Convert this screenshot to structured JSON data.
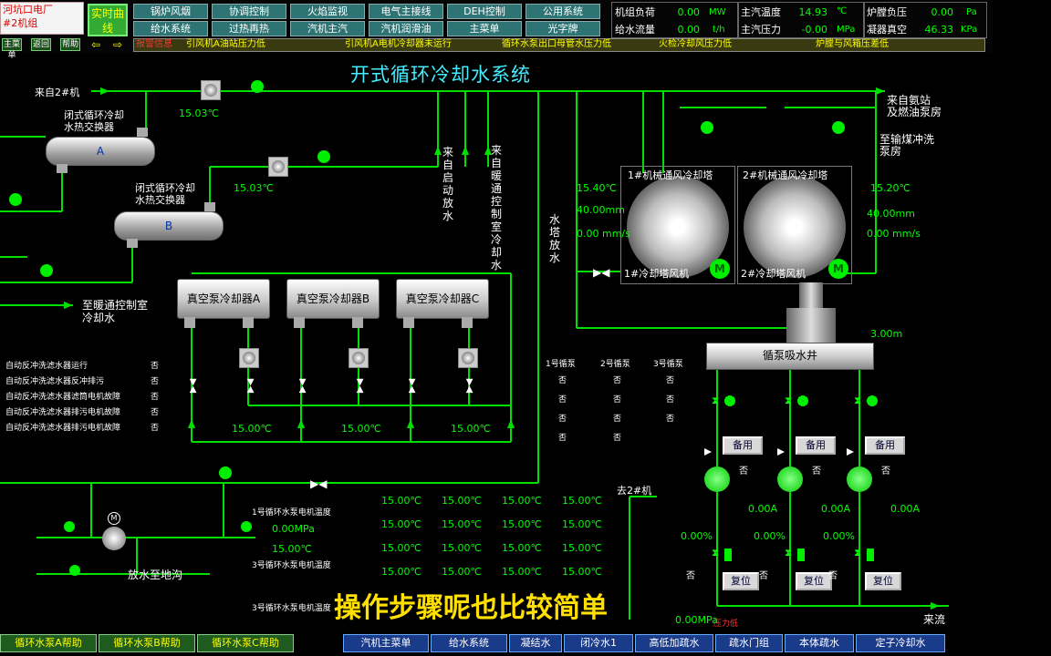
{
  "header": {
    "plant_name": "河坑口电厂",
    "unit_name": "#2机组",
    "realtime_curve": "实时曲线",
    "nav_row1": [
      "锅炉风烟",
      "协调控制",
      "火焰监视",
      "电气主接线",
      "DEH控制",
      "公用系统"
    ],
    "nav_row2": [
      "给水系统",
      "过热再热",
      "汽机主汽",
      "汽机润滑油",
      "主菜单",
      "光字牌"
    ],
    "mini_buttons": [
      "主菜单",
      "返回",
      "帮助"
    ],
    "arrow_prev": "⇦",
    "arrow_next": "⇨",
    "metrics_left": [
      {
        "label": "机组负荷",
        "value": "0.00",
        "unit": "MW"
      },
      {
        "label": "给水流量",
        "value": "0.00",
        "unit": "t/h"
      }
    ],
    "metrics_mid": [
      {
        "label": "主汽温度",
        "value": "14.93",
        "unit": "℃"
      },
      {
        "label": "主汽压力",
        "value": "-0.00",
        "unit": "MPa"
      }
    ],
    "metrics_right": [
      {
        "label": "炉膛负压",
        "value": "0.00",
        "unit": "Pa"
      },
      {
        "label": "凝器真空",
        "value": "46.33",
        "unit": "KPa"
      }
    ],
    "alarm_title": "报警信息",
    "alarms": [
      "引风机A油站压力低",
      "引风机A电机冷却器未运行",
      "循环水泵出口母管水压力低",
      "火检冷却风压力低",
      "炉膛与风箱压差低"
    ]
  },
  "title": "开式循环冷却水系统",
  "labels": {
    "from_2": "来自2#机",
    "hx_a_label": "闭式循环冷却\n水热交换器",
    "hx_b_label": "闭式循环冷却\n水热交换器",
    "hx_a": "A",
    "hx_b": "B",
    "temp_a": "15.03℃",
    "temp_b": "15.03℃",
    "hvac_room": "至暖通控制室\n冷却水",
    "v_start_drain": "来自启动放水",
    "v_hvac": "来自暖通控制室冷却水",
    "tower_drain": "水塔放水",
    "tower1_name": "1#机械通风冷却塔",
    "tower2_name": "2#机械通风冷却塔",
    "tower1_fan": "1#冷却塔风机",
    "tower2_fan": "2#冷却塔风机",
    "tower1_temp": "15.40℃",
    "tower1_level": "40.00mm",
    "tower1_speed": "0.00 mm/s",
    "tower2_temp": "15.20℃",
    "tower2_level": "40.00mm",
    "tower2_speed": "0.00 mm/s",
    "from_ammonia": "来自氨站\n及燃油泵房",
    "to_coal": "至输煤冲洗\n泵房",
    "well": "循泵吸水井",
    "well_level": "3.00m",
    "to_2": "去2#机",
    "drain_floor": "放水至地沟",
    "return_flow": "来流",
    "pressure_low": "压力低"
  },
  "coolers": [
    "真空泵冷却器A",
    "真空泵冷却器B",
    "真空泵冷却器C"
  ],
  "cooler_temps": [
    "15.00℃",
    "15.00℃",
    "15.00℃"
  ],
  "filter_status": [
    {
      "label": "自动反冲洗滤水器运行",
      "value": "否"
    },
    {
      "label": "自动反冲洗滤水器反冲排污",
      "value": "否"
    },
    {
      "label": "自动反冲洗滤水器滤筒电机故障",
      "value": "否"
    },
    {
      "label": "自动反冲洗滤水器排污电机故障",
      "value": "否"
    },
    {
      "label": "自动反冲洗滤水器排污电机故障",
      "value": "否"
    }
  ],
  "pump_status_headers": [
    "1号循泵",
    "2号循泵",
    "3号循泵"
  ],
  "pump_status": [
    [
      "否",
      "否",
      "否",
      "否"
    ],
    [
      "否",
      "否",
      "否",
      "否"
    ],
    [
      "否",
      "否",
      "否",
      ""
    ]
  ],
  "motor_temps": {
    "label1": "1号循环水泵电机温度",
    "label2": "3号循环水泵电机温度",
    "label3": "3号循环水泵电机温度",
    "pressure": "0.00MPa",
    "temp_left": "15.00℃",
    "grid": [
      [
        "15.00℃",
        "15.00℃",
        "15.00℃",
        "15.00℃"
      ],
      [
        "15.00℃",
        "15.00℃",
        "15.00℃",
        "15.00℃"
      ],
      [
        "15.00℃",
        "15.00℃",
        "15.00℃",
        "15.00℃"
      ],
      [
        "15.00℃",
        "15.00℃",
        "15.00℃",
        "15.00℃"
      ]
    ],
    "bottom_value": "0.00MPa"
  },
  "pumps": [
    {
      "standby": "备用",
      "state": "否",
      "current": "0.00A",
      "open": "0.00%",
      "valve": "否",
      "reset": "复位"
    },
    {
      "standby": "备用",
      "state": "否",
      "current": "0.00A",
      "open": "0.00%",
      "valve": "否",
      "reset": "复位"
    },
    {
      "standby": "备用",
      "state": "否",
      "current": "0.00A",
      "open": "0.00%",
      "valve": "否",
      "reset": "复位"
    }
  ],
  "bottom_left": [
    "循环水泵A帮助",
    "循环水泵B帮助",
    "循环水泵C帮助"
  ],
  "bottom_right": [
    "汽机主菜单",
    "给水系统",
    "凝结水",
    "闭冷水1",
    "高低加疏水",
    "疏水门组",
    "本体疏水",
    "定子冷却水"
  ],
  "subtitle": "操作步骤呢也比较简单",
  "colors": {
    "pipe": "#00e000",
    "accent": "#44eeff",
    "value": "#00ff00",
    "alarm": "#ff3333"
  }
}
